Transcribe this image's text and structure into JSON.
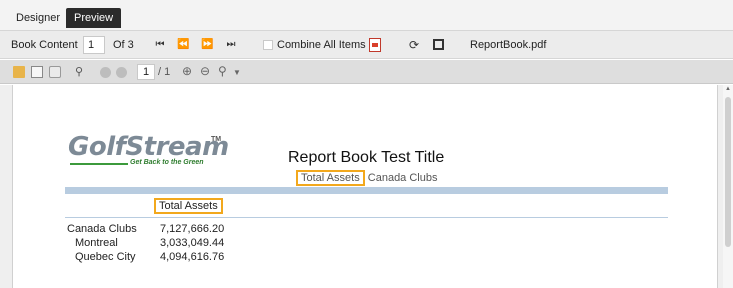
{
  "tabs": [
    {
      "label": "Designer",
      "active": false
    },
    {
      "label": "Preview",
      "active": true
    }
  ],
  "book_toolbar": {
    "label": "Book Content",
    "current_page": "1",
    "of_text": "Of 3",
    "nav_first": "⏮",
    "nav_prev": "⏪",
    "nav_next": "⏩",
    "nav_last": "⏭",
    "combine_label": "Combine All Items",
    "combine_checked": false,
    "filename": "ReportBook.pdf",
    "icons": [
      "first-page-icon",
      "prev-page-icon",
      "next-page-icon",
      "last-page-icon",
      "pdf-icon",
      "refresh-icon",
      "stop-icon"
    ]
  },
  "viewer_toolbar": {
    "page_value": "1",
    "page_total": "/ 1",
    "icons": [
      "open-folder-icon",
      "save-icon",
      "print-icon",
      "find-icon",
      "back-icon",
      "forward-icon",
      "zoom-in-icon",
      "zoom-out-icon",
      "zoom-icon",
      "dropdown-caret-icon"
    ]
  },
  "report": {
    "logo_text": "GolfStream",
    "logo_tm": "TM",
    "tagline": "Get Back to the Green",
    "title": "Report Book Test Title",
    "breadcrumb_active": "Total Assets",
    "breadcrumb_next": "Canada Clubs",
    "column_header": "Total Assets",
    "rows": [
      {
        "label": "Canada Clubs",
        "value": "7,127,666.20"
      },
      {
        "label": "Montreal",
        "value": "3,033,049.44"
      },
      {
        "label": "Quebec City",
        "value": "4,094,616.76"
      }
    ]
  },
  "colors": {
    "active_tab": "#2b2b2b",
    "highlight": "#f2a81d",
    "band": "#b8cce0",
    "logo_gray": "#7d8a96",
    "logo_green": "#2f7d2f"
  }
}
